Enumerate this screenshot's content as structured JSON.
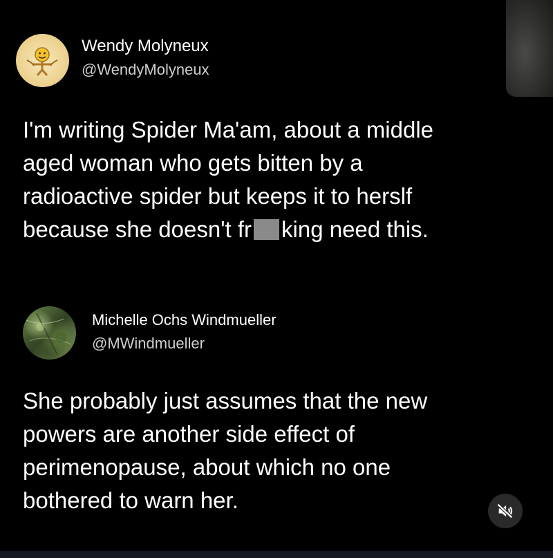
{
  "tweet": {
    "display_name": "Wendy Molyneux",
    "handle": "@WendyMolyneux",
    "avatar_icon": "smiley-cartoon-icon",
    "text_lines": [
      "I'm writing Spider Ma'am, about a middle",
      "aged woman who gets bitten by a",
      "radioactive spider but keeps it to herslf"
    ],
    "last_line_before": "because she doesn't fr",
    "last_line_after": "king need this."
  },
  "reply": {
    "display_name": "Michelle Ochs Windmueller",
    "handle": "@MWindmueller",
    "avatar_icon": "tree-photo-icon",
    "text_lines": [
      "She probably just assumes that the new",
      "powers are another side effect of",
      "perimenopause, about which no one",
      "bothered to warn her."
    ]
  },
  "controls": {
    "mute_icon": "speaker-muted-icon"
  },
  "colors": {
    "background": "#000000",
    "text": "#ffffff",
    "handle": "#cfcfcf",
    "censor": "#8a8a8a"
  }
}
